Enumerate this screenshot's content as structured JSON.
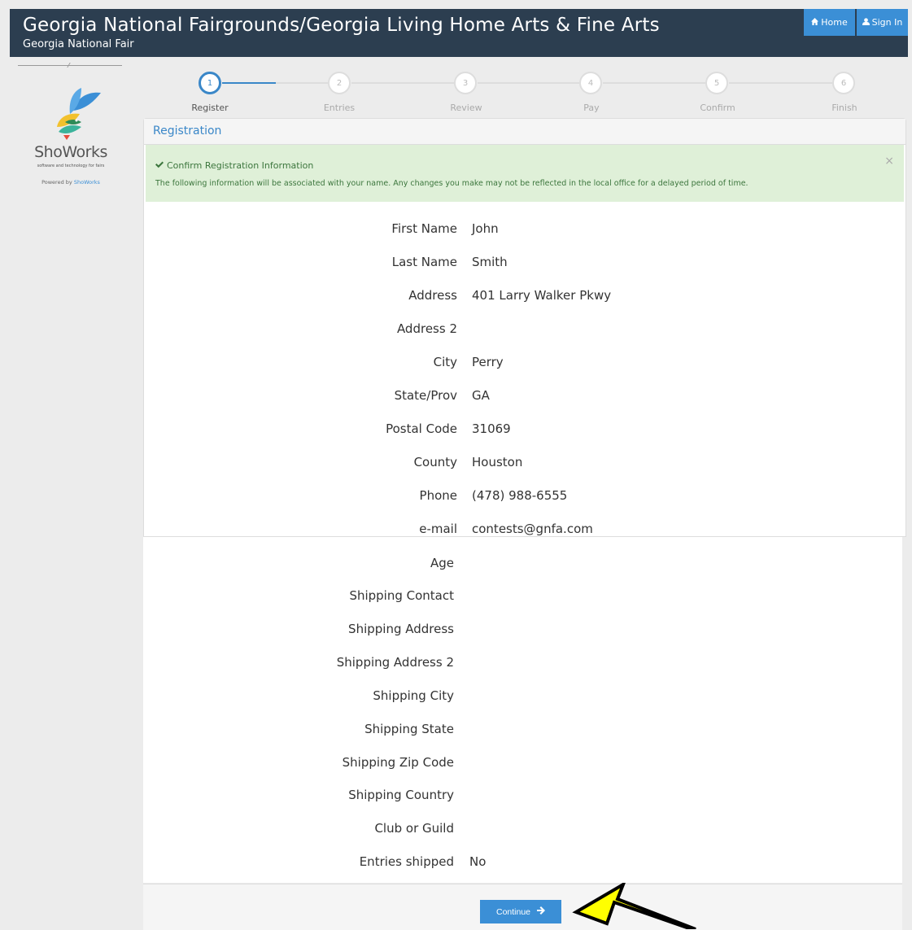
{
  "header": {
    "title": "Georgia National Fairgrounds/Georgia Living Home Arts & Fine Arts",
    "subtitle": "Georgia National Fair",
    "home_label": "Home",
    "signin_label": "Sign In",
    "bg_color": "#2c3e50",
    "accent_color": "#3b8fd6"
  },
  "sidebar": {
    "logo_text": "ShoWorks",
    "tagline": "software and technology for fairs",
    "powered_prefix": "Powered by",
    "powered_link": "ShoWorks"
  },
  "steps": [
    {
      "num": "1",
      "label": "Register",
      "active": true
    },
    {
      "num": "2",
      "label": "Entries",
      "active": false
    },
    {
      "num": "3",
      "label": "Review",
      "active": false
    },
    {
      "num": "4",
      "label": "Pay",
      "active": false
    },
    {
      "num": "5",
      "label": "Confirm",
      "active": false
    },
    {
      "num": "6",
      "label": "Finish",
      "active": false
    }
  ],
  "panel": {
    "heading": "Registration",
    "alert_title": "Confirm Registration Information",
    "alert_message": "The following information will be associated with your name. Any changes you make may not be reflected in the local office for a delayed period of time.",
    "close_symbol": "×"
  },
  "fields": [
    {
      "label": "First Name",
      "value": "John"
    },
    {
      "label": "Last Name",
      "value": "Smith"
    },
    {
      "label": "Address",
      "value": "401 Larry Walker Pkwy"
    },
    {
      "label": "Address 2",
      "value": ""
    },
    {
      "label": "City",
      "value": "Perry"
    },
    {
      "label": "State/Prov",
      "value": "GA"
    },
    {
      "label": "Postal Code",
      "value": "31069"
    },
    {
      "label": "County",
      "value": "Houston"
    },
    {
      "label": "Phone",
      "value": "(478) 988-6555"
    },
    {
      "label": "e-mail",
      "value": "contests@gnfa.com"
    },
    {
      "label": "Age",
      "value": ""
    },
    {
      "label": "Shipping Contact",
      "value": ""
    },
    {
      "label": "Shipping Address",
      "value": ""
    },
    {
      "label": "Shipping Address 2",
      "value": ""
    },
    {
      "label": "Shipping City",
      "value": ""
    },
    {
      "label": "Shipping State",
      "value": ""
    },
    {
      "label": "Shipping Zip Code",
      "value": ""
    },
    {
      "label": "Shipping Country",
      "value": ""
    },
    {
      "label": "Club or Guild",
      "value": ""
    },
    {
      "label": "Entries shipped",
      "value": "No"
    }
  ],
  "actions": {
    "continue_label": "Continue"
  },
  "annotation": {
    "arrow_color": "#ffff00"
  }
}
